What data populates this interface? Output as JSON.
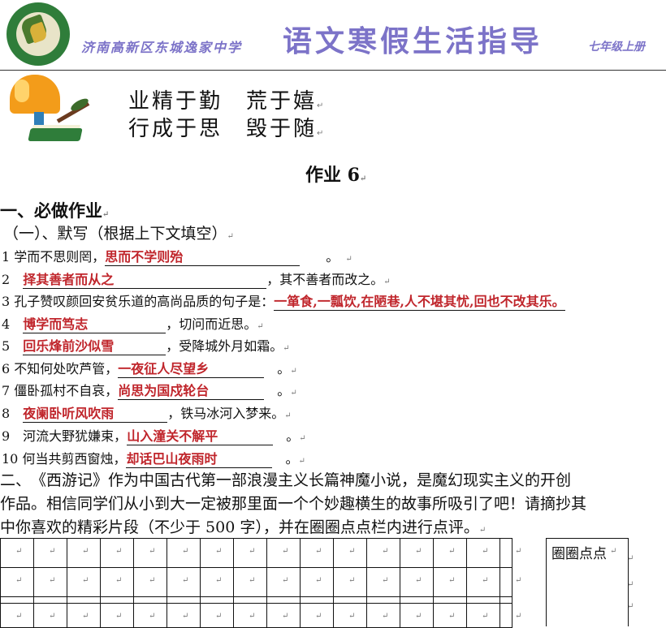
{
  "header": {
    "school": "济南高新区东城逸家中学",
    "title": "语文寒假生活指导",
    "grade": "七年级上册",
    "logo_text": "DONG CHENG YI JIA MIDDLE SCHOOL JINAN INNOVATION ZONE"
  },
  "motto": {
    "line1": "业精于勤　荒于嬉",
    "line2": "行成于思　毁于随"
  },
  "homework_title": "作业 6",
  "section1": {
    "heading": "一、必做作业",
    "sub_heading": "（一）、默写（根据上下文填空）",
    "items": [
      {
        "prefix": "1 学而不思则罔，",
        "answer": "思而不学则殆",
        "suffix": "。"
      },
      {
        "prefix": "2　",
        "answer": "择其善者而从之",
        "suffix": "，其不善者而改之。"
      },
      {
        "prefix": "3 孔子赞叹颜回安贫乐道的高尚品质的句子是：",
        "answer": "一箪食,一瓢饮,在陋巷,人不堪其忧,回也不改其乐。",
        "suffix": ""
      },
      {
        "prefix": "4　",
        "answer": "博学而笃志",
        "suffix": "，切问而近思。"
      },
      {
        "prefix": "5　",
        "answer": "回乐烽前沙似雪",
        "suffix": "，受降城外月如霜。"
      },
      {
        "prefix": "6 不知何处吹芦管，",
        "answer": "一夜征人尽望乡",
        "suffix": "。"
      },
      {
        "prefix": "7 僵卧孤村不自哀，",
        "answer": "尚思为国戍轮台",
        "suffix": "。"
      },
      {
        "prefix": "8　",
        "answer": "夜阑卧听风吹雨",
        "suffix": "，铁马冰河入梦来。"
      },
      {
        "prefix": "9　河流大野犹嫌束，",
        "answer": "山入潼关不解平",
        "suffix": "。"
      },
      {
        "prefix": " 10 何当共剪西窗烛，",
        "answer": "却话巴山夜雨时",
        "suffix": "。"
      }
    ]
  },
  "section2": {
    "line1": "二、　《西游记》作为中国古代第一部浪漫主义长篇神魔小说，是魔幻现实主义的开创",
    "line2": "作品。相信同学们从小到大一定被那里面一个个妙趣横生的故事所吸引了吧！请摘抄其",
    "line3": "中你喜欢的精彩片段（不少于 500 字），并在圈圈点点栏内进行点评。"
  },
  "comment_label": "圈圈点点"
}
